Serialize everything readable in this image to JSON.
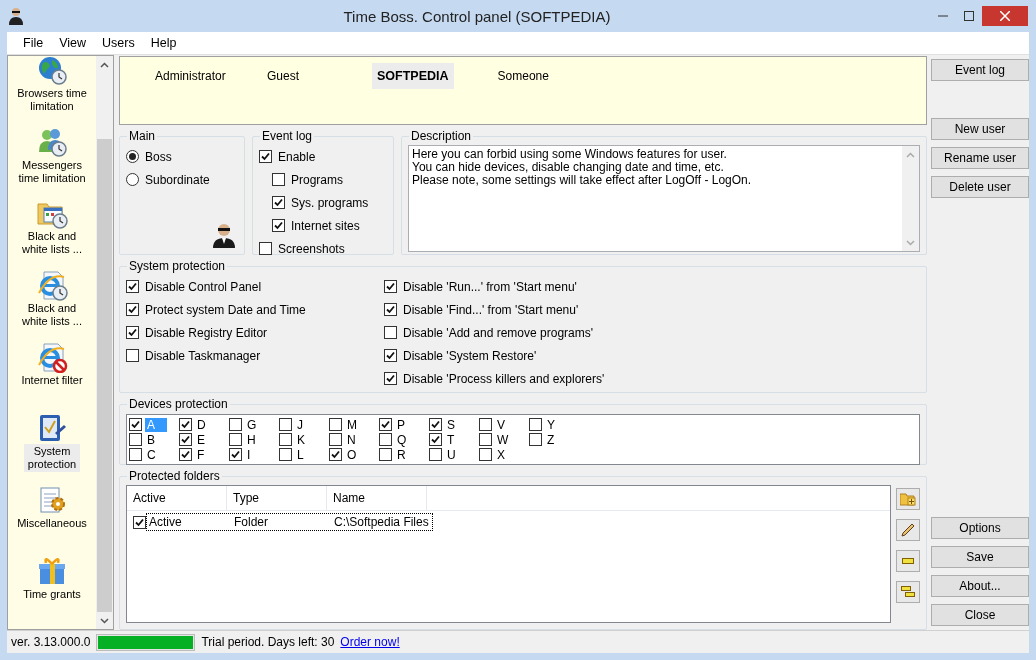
{
  "window": {
    "title": "Time Boss. Control panel (SOFTPEDIA)"
  },
  "menu": [
    "File",
    "View",
    "Users",
    "Help"
  ],
  "sidebar": {
    "items": [
      {
        "label": "Browsers time limitation",
        "selected": false
      },
      {
        "label": "Messengers time limitation",
        "selected": false
      },
      {
        "label": "Black and white lists ...",
        "selected": false
      },
      {
        "label": "Black and white lists ...",
        "selected": false
      },
      {
        "label": "Internet filter",
        "selected": false
      },
      {
        "label": "System protection",
        "selected": true
      },
      {
        "label": "Miscellaneous",
        "selected": false
      },
      {
        "label": "Time grants",
        "selected": false
      }
    ]
  },
  "users": [
    {
      "name": "Administrator",
      "selected": false
    },
    {
      "name": "Guest",
      "selected": false
    },
    {
      "name": "SOFTPEDIA",
      "selected": true
    },
    {
      "name": "Someone",
      "selected": false
    }
  ],
  "main": {
    "title": "Main",
    "options": [
      {
        "label": "Boss",
        "selected": true
      },
      {
        "label": "Subordinate",
        "selected": false
      }
    ]
  },
  "event_log": {
    "title": "Event log",
    "items": [
      {
        "label": "Enable",
        "checked": true,
        "children": [
          {
            "label": "Programs",
            "checked": false
          },
          {
            "label": "Sys. programs",
            "checked": true
          },
          {
            "label": "Internet sites",
            "checked": true
          }
        ]
      },
      {
        "label": "Screenshots",
        "checked": false
      }
    ]
  },
  "description": {
    "title": "Description",
    "lines": [
      "Here you can forbid using some Windows features for user.",
      "You can hide devices, disable changing date and time, etc.",
      "Please note, some settings will take effect after LogOff - LogOn."
    ]
  },
  "system_protection": {
    "title": "System protection",
    "columns": [
      [
        {
          "label": "Disable Control Panel",
          "checked": true
        },
        {
          "label": "Protect system Date and Time",
          "checked": true
        },
        {
          "label": "Disable Registry Editor",
          "checked": true
        },
        {
          "label": "Disable Taskmanager",
          "checked": false
        }
      ],
      [
        {
          "label": "Disable 'Run...' from 'Start menu'",
          "checked": true
        },
        {
          "label": "Disable 'Find...' from 'Start menu'",
          "checked": true
        },
        {
          "label": "Disable 'Add and remove programs'",
          "checked": false
        },
        {
          "label": "Disable 'System Restore'",
          "checked": true
        },
        {
          "label": "Disable 'Process killers and explorers'",
          "checked": true
        }
      ]
    ]
  },
  "devices_protection": {
    "title": "Devices protection",
    "drives": [
      {
        "label": "A",
        "checked": true,
        "selected": true
      },
      {
        "label": "B",
        "checked": false,
        "selected": false
      },
      {
        "label": "C",
        "checked": false,
        "selected": false
      },
      {
        "label": "D",
        "checked": true,
        "selected": false
      },
      {
        "label": "E",
        "checked": true,
        "selected": false
      },
      {
        "label": "F",
        "checked": true,
        "selected": false
      },
      {
        "label": "G",
        "checked": false,
        "selected": false
      },
      {
        "label": "H",
        "checked": false,
        "selected": false
      },
      {
        "label": "I",
        "checked": true,
        "selected": false
      },
      {
        "label": "J",
        "checked": false,
        "selected": false
      },
      {
        "label": "K",
        "checked": false,
        "selected": false
      },
      {
        "label": "L",
        "checked": false,
        "selected": false
      },
      {
        "label": "M",
        "checked": false,
        "selected": false
      },
      {
        "label": "N",
        "checked": false,
        "selected": false
      },
      {
        "label": "O",
        "checked": true,
        "selected": false
      },
      {
        "label": "P",
        "checked": true,
        "selected": false
      },
      {
        "label": "Q",
        "checked": false,
        "selected": false
      },
      {
        "label": "R",
        "checked": false,
        "selected": false
      },
      {
        "label": "S",
        "checked": true,
        "selected": false
      },
      {
        "label": "T",
        "checked": true,
        "selected": false
      },
      {
        "label": "U",
        "checked": false,
        "selected": false
      },
      {
        "label": "V",
        "checked": false,
        "selected": false
      },
      {
        "label": "W",
        "checked": false,
        "selected": false
      },
      {
        "label": "X",
        "checked": false,
        "selected": false
      },
      {
        "label": "Y",
        "checked": false,
        "selected": false
      },
      {
        "label": "Z",
        "checked": false,
        "selected": false
      }
    ]
  },
  "protected_folders": {
    "title": "Protected folders",
    "columns": [
      "Active",
      "Type",
      "Name"
    ],
    "rows": [
      {
        "checked": true,
        "cells": [
          "Active",
          "Folder",
          "C:\\Softpedia Files"
        ]
      }
    ]
  },
  "buttons_top": [
    "Event log"
  ],
  "user_buttons": [
    "New user",
    "Rename user",
    "Delete user"
  ],
  "bottom_buttons": [
    "Options",
    "Save",
    "About...",
    "Close"
  ],
  "status_bar": {
    "version": "ver. 3.13.000.0",
    "trial": {
      "level": 1
    },
    "text": "Trial period. Days left: 30",
    "link": "Order now!"
  }
}
